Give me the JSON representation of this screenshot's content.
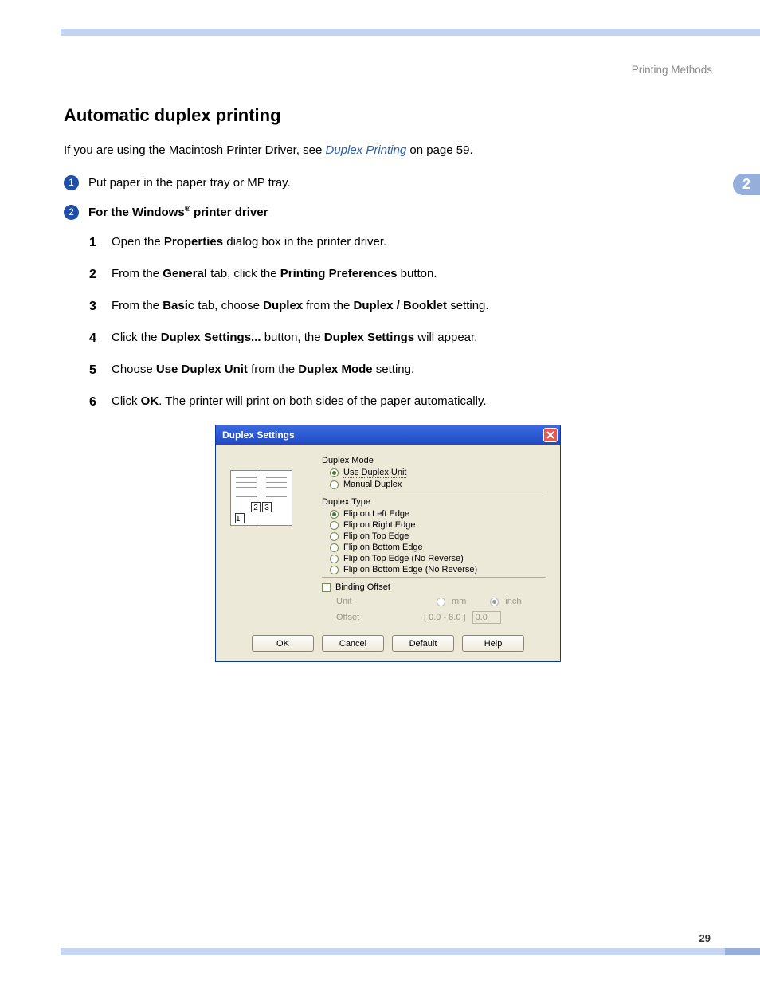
{
  "header": {
    "section": "Printing Methods"
  },
  "sideTab": "2",
  "pageNumber": "29",
  "title": "Automatic duplex printing",
  "intro": {
    "pre": "If you are using the Macintosh Printer Driver, see ",
    "link": "Duplex Printing",
    "post": " on page 59."
  },
  "majorSteps": {
    "s1": {
      "num": "1",
      "text": "Put paper in the paper tray or MP tray."
    },
    "s2": {
      "num": "2",
      "pre": "For the Windows",
      "reg": "®",
      "post": " printer driver"
    }
  },
  "subSteps": {
    "a": {
      "num": "1",
      "t1": "Open the ",
      "b1": "Properties",
      "t2": " dialog box in the printer driver."
    },
    "b": {
      "num": "2",
      "t1": "From the ",
      "b1": "General",
      "t2": " tab, click the ",
      "b2": "Printing Preferences",
      "t3": " button."
    },
    "c": {
      "num": "3",
      "t1": "From the ",
      "b1": "Basic",
      "t2": " tab, choose ",
      "b2": "Duplex",
      "t3": " from the ",
      "b3": "Duplex / Booklet",
      "t4": " setting."
    },
    "d": {
      "num": "4",
      "t1": "Click the ",
      "b1": "Duplex Settings...",
      "t2": " button, the ",
      "b2": "Duplex Settings",
      "t3": " will appear."
    },
    "e": {
      "num": "5",
      "t1": "Choose ",
      "b1": "Use Duplex Unit",
      "t2": " from the ",
      "b2": "Duplex Mode",
      "t3": " setting."
    },
    "f": {
      "num": "6",
      "t1": "Click ",
      "b1": "OK",
      "t2": ". The printer will print on both sides of the paper automatically."
    }
  },
  "dialog": {
    "title": "Duplex Settings",
    "illus": {
      "n1": "1",
      "n2": "2",
      "n3": "3"
    },
    "mode": {
      "label": "Duplex Mode",
      "opt1": "Use Duplex Unit",
      "opt2": "Manual Duplex"
    },
    "type": {
      "label": "Duplex Type",
      "o1": "Flip on Left Edge",
      "o2": "Flip on Right Edge",
      "o3": "Flip on Top Edge",
      "o4": "Flip on Bottom Edge",
      "o5": "Flip on Top Edge (No Reverse)",
      "o6": "Flip on Bottom Edge (No Reverse)"
    },
    "binding": {
      "check": "Binding Offset",
      "unitLabel": "Unit",
      "mm": "mm",
      "inch": "inch",
      "offsetLabel": "Offset",
      "range": "[ 0.0 - 8.0 ]",
      "value": "0.0"
    },
    "buttons": {
      "ok": "OK",
      "cancel": "Cancel",
      "def": "Default",
      "help": "Help"
    }
  }
}
